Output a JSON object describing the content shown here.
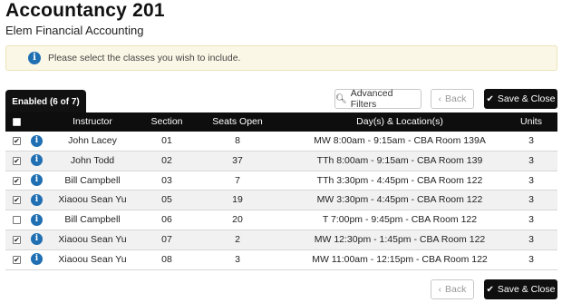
{
  "course": {
    "title": "Accountancy 201",
    "subtitle": "Elem Financial Accounting"
  },
  "notice": {
    "icon": "info-icon",
    "text": "Please select the classes you wish to include."
  },
  "tab": {
    "label": "Enabled (6 of 7)"
  },
  "toolbar": {
    "advanced_filters_label": "Advanced Filters",
    "back_label": "Back",
    "save_close_label": "Save & Close"
  },
  "columns": {
    "instructor": "Instructor",
    "section": "Section",
    "seats": "Seats Open",
    "days": "Day(s) & Location(s)",
    "units": "Units"
  },
  "rows": [
    {
      "checked": true,
      "instructor": "John Lacey",
      "section": "01",
      "seats": "8",
      "days": "MW 8:00am - 9:15am - CBA Room 139A",
      "units": "3"
    },
    {
      "checked": true,
      "instructor": "John Todd",
      "section": "02",
      "seats": "37",
      "days": "TTh 8:00am - 9:15am - CBA Room 139",
      "units": "3"
    },
    {
      "checked": true,
      "instructor": "Bill Campbell",
      "section": "03",
      "seats": "7",
      "days": "TTh 3:30pm - 4:45pm - CBA Room 122",
      "units": "3"
    },
    {
      "checked": true,
      "instructor": "Xiaoou Sean Yu",
      "section": "05",
      "seats": "19",
      "days": "MW 3:30pm - 4:45pm - CBA Room 122",
      "units": "3"
    },
    {
      "checked": false,
      "instructor": "Bill Campbell",
      "section": "06",
      "seats": "20",
      "days": "T 7:00pm - 9:45pm - CBA Room 122",
      "units": "3"
    },
    {
      "checked": true,
      "instructor": "Xiaoou Sean Yu",
      "section": "07",
      "seats": "2",
      "days": "MW 12:30pm - 1:45pm - CBA Room 122",
      "units": "3"
    },
    {
      "checked": true,
      "instructor": "Xiaoou Sean Yu",
      "section": "08",
      "seats": "3",
      "days": "MW 11:00am - 12:15pm - CBA Room 122",
      "units": "3"
    }
  ],
  "colors": {
    "accent": "#1f6fb2",
    "header_bg": "#0e0e0e",
    "notice_bg": "#fbf7e6"
  }
}
